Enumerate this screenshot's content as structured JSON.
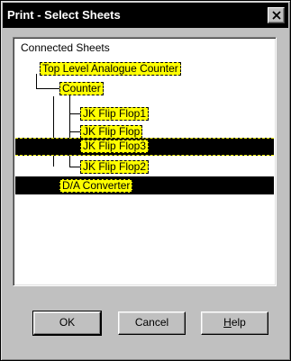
{
  "window": {
    "title": "Print - Select Sheets",
    "close_glyph": "×"
  },
  "tree": {
    "root_label": "Connected Sheets",
    "items": [
      {
        "label": "Top Level Analogue Counter",
        "level": 0,
        "highlighted": false
      },
      {
        "label": "Counter",
        "level": 1,
        "highlighted": false
      },
      {
        "label": "JK Flip Flop1",
        "level": 2,
        "highlighted": false
      },
      {
        "label": "JK Flip Flop",
        "level": 2,
        "highlighted": false
      },
      {
        "label": "JK Flip Flop3",
        "level": 2,
        "highlighted": true,
        "focused": true
      },
      {
        "label": "JK Flip Flop2",
        "level": 2,
        "highlighted": false
      },
      {
        "label": "D/A Converter",
        "level": 1,
        "highlighted": true
      }
    ]
  },
  "buttons": {
    "ok": "OK",
    "cancel": "Cancel",
    "help_mnemonic": "H",
    "help_rest": "elp"
  },
  "colors": {
    "dialog_face": "#c0c0c0",
    "titlebar": "#000000",
    "node_fill": "#ffff00",
    "selection_band": "#000000"
  }
}
